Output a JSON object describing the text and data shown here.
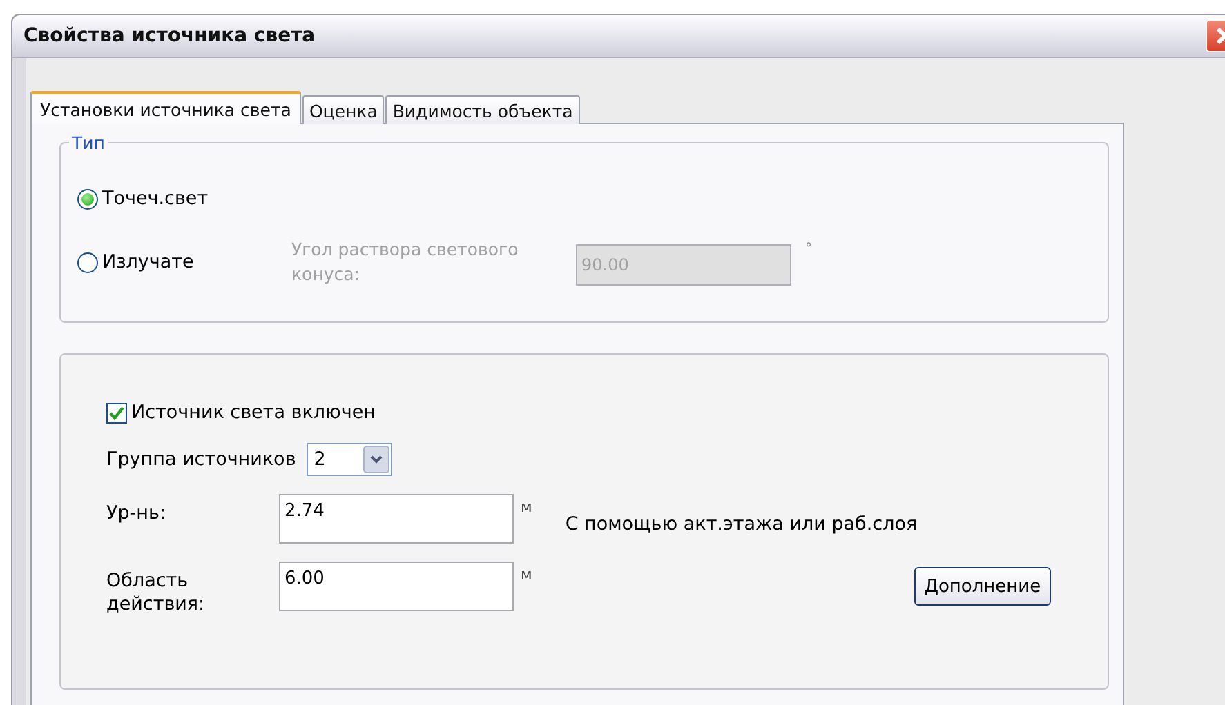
{
  "window": {
    "title": "Свойства источника света"
  },
  "tabs": [
    {
      "label": "Установки источника света",
      "selected": true
    },
    {
      "label": "Оценка",
      "selected": false
    },
    {
      "label": "Видимость объекта",
      "selected": false
    }
  ],
  "type_group": {
    "legend": "Тип",
    "options": [
      {
        "label": "Точеч.свет",
        "selected": true
      },
      {
        "label": "Излучате",
        "selected": false
      }
    ],
    "cone_label": "Угол раствора светового конуса:",
    "cone_value": "90.00",
    "cone_unit": "°",
    "disabled": true
  },
  "light_on": {
    "label": "Источник света включен",
    "checked": true
  },
  "group": {
    "label": "Группа источников",
    "value": "2"
  },
  "level": {
    "label": "Ур-нь:",
    "value": "2.74",
    "unit": "м",
    "note": "С помощью акт.этажа или раб.слоя"
  },
  "range": {
    "label": "Область действия:",
    "value": "6.00",
    "unit": "м"
  },
  "more_button": "Дополнение"
}
